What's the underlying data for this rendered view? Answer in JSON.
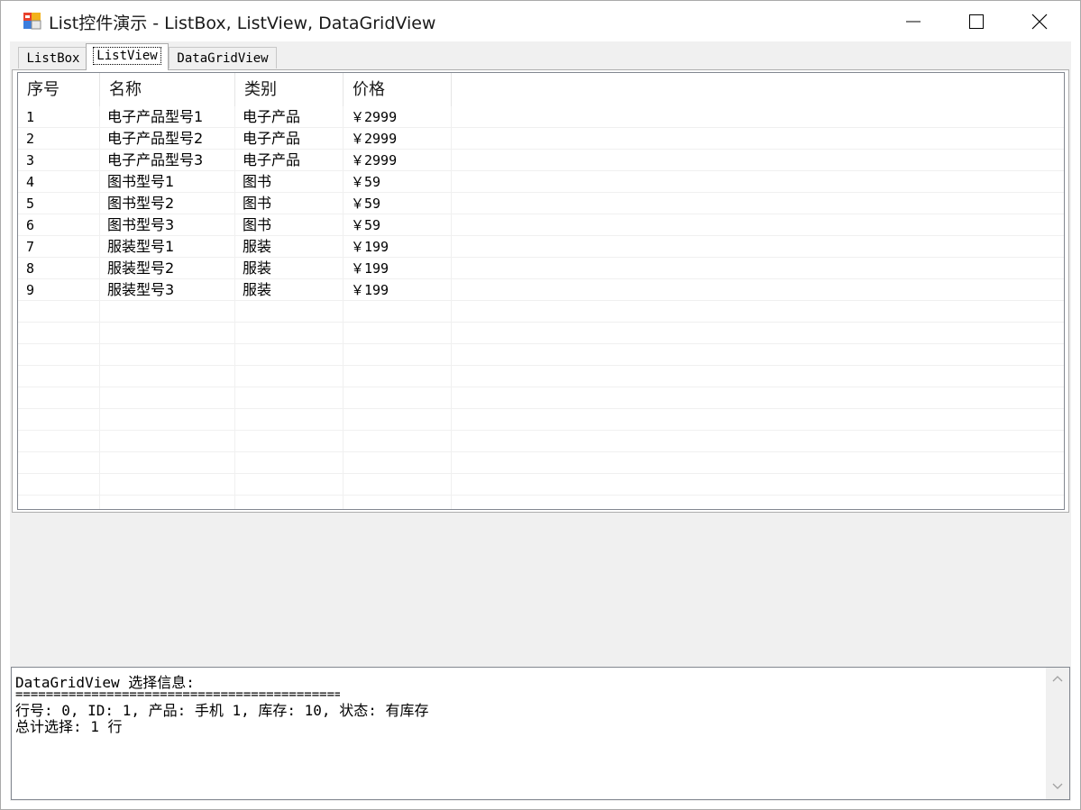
{
  "window": {
    "title": "List控件演示 - ListBox, ListView, DataGridView"
  },
  "tabs": [
    {
      "label": "ListBox",
      "selected": false
    },
    {
      "label": "ListView",
      "selected": true
    },
    {
      "label": "DataGridView",
      "selected": false
    }
  ],
  "listview": {
    "columns": [
      "序号",
      "名称",
      "类别",
      "价格"
    ],
    "rows": [
      [
        "1",
        "电子产品型号1",
        "电子产品",
        "￥2999"
      ],
      [
        "2",
        "电子产品型号2",
        "电子产品",
        "￥2999"
      ],
      [
        "3",
        "电子产品型号3",
        "电子产品",
        "￥2999"
      ],
      [
        "4",
        "图书型号1",
        "图书",
        "￥59"
      ],
      [
        "5",
        "图书型号2",
        "图书",
        "￥59"
      ],
      [
        "6",
        "图书型号3",
        "图书",
        "￥59"
      ],
      [
        "7",
        "服装型号1",
        "服装",
        "￥199"
      ],
      [
        "8",
        "服装型号2",
        "服装",
        "￥199"
      ],
      [
        "9",
        "服装型号3",
        "服装",
        "￥199"
      ]
    ]
  },
  "info": {
    "title": "DataGridView 选择信息:",
    "separator": "==================================================",
    "lines": [
      "行号: 0, ID: 1, 产品: 手机 1, 库存: 10, 状态: 有库存",
      "总计选择: 1 行"
    ]
  }
}
